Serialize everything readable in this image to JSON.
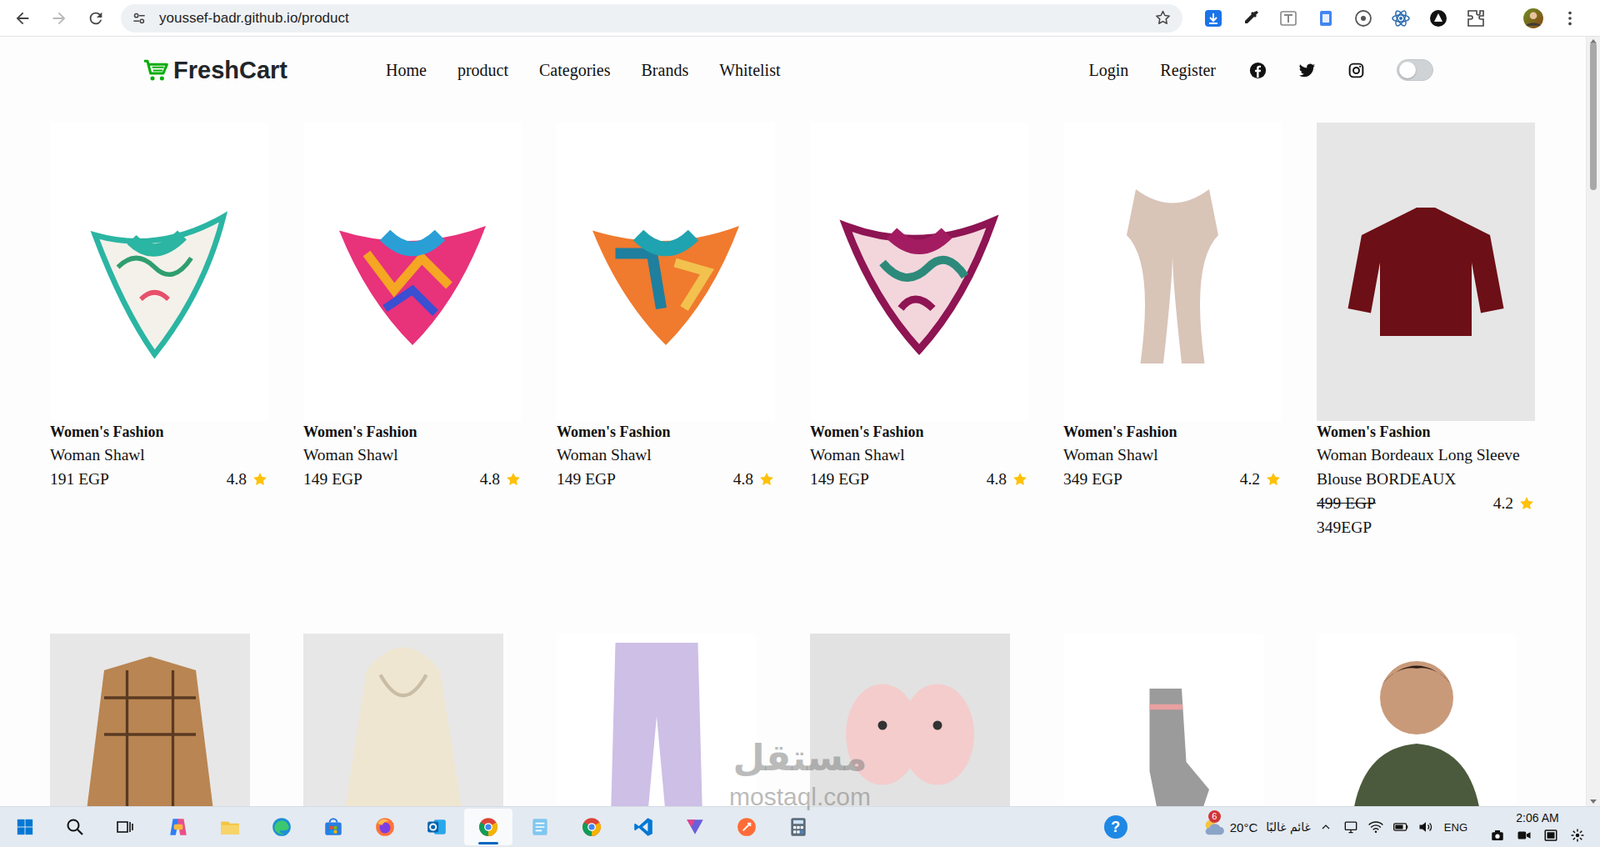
{
  "browser": {
    "url": "youssef-badr.github.io/product",
    "forward_disabled": true
  },
  "nav": {
    "logo": "FreshCart",
    "links": [
      {
        "label": "Home",
        "selected": false
      },
      {
        "label": "product",
        "selected": false
      },
      {
        "label": "Categories",
        "selected": false
      },
      {
        "label": "Brands",
        "selected": false
      },
      {
        "label": "Whitelist",
        "selected": false
      }
    ],
    "auth": [
      {
        "label": "Login"
      },
      {
        "label": "Register"
      }
    ],
    "dark_mode": {
      "on": false
    }
  },
  "products": [
    {
      "category": "Women's Fashion",
      "title": "Woman Shawl",
      "price": "191 EGP",
      "rating": "4.8"
    },
    {
      "category": "Women's Fashion",
      "title": "Woman Shawl",
      "price": "149 EGP",
      "rating": "4.8"
    },
    {
      "category": "Women's Fashion",
      "title": "Woman Shawl",
      "price": "149 EGP",
      "rating": "4.8"
    },
    {
      "category": "Women's Fashion",
      "title": "Woman Shawl",
      "price": "149 EGP",
      "rating": "4.8"
    },
    {
      "category": "Women's Fashion",
      "title": "Woman Shawl",
      "price": "349 EGP",
      "rating": "4.2"
    },
    {
      "category": "Women's Fashion",
      "title": "Woman Bordeaux Long Sleeve Blouse BORDEAUX",
      "old_price": "499 EGP",
      "price": "349EGP",
      "rating": "4.2"
    }
  ],
  "more_products": [
    {
      "cut_off": true
    },
    {
      "cut_off": true
    },
    {
      "cut_off": true
    },
    {
      "cut_off": true
    },
    {
      "cut_off": true
    },
    {
      "cut_off": true
    }
  ],
  "page_scroll": {
    "level": 0
  },
  "taskbar": {
    "apps": [
      {
        "kind": "copilot",
        "selected": false
      },
      {
        "kind": "explorer",
        "selected": false
      },
      {
        "kind": "edge",
        "selected": false
      },
      {
        "kind": "store",
        "selected": false
      },
      {
        "kind": "firefox",
        "selected": false
      },
      {
        "kind": "outlook",
        "selected": false
      },
      {
        "kind": "chrome",
        "selected": true
      },
      {
        "kind": "notepad",
        "selected": false
      },
      {
        "kind": "chrome",
        "selected": false
      },
      {
        "kind": "vscode",
        "selected": false
      },
      {
        "kind": "automate",
        "selected": false
      },
      {
        "kind": "postman",
        "selected": false
      },
      {
        "kind": "calculator",
        "selected": false
      }
    ],
    "help": "?",
    "weather": {
      "badge": "6",
      "temperature": "20°C",
      "condition": "غائم غالبًا"
    },
    "language": "ENG",
    "time": "2:06 AM"
  },
  "watermark": {
    "arabic": "مستقل",
    "latin": "mostaql.com"
  }
}
